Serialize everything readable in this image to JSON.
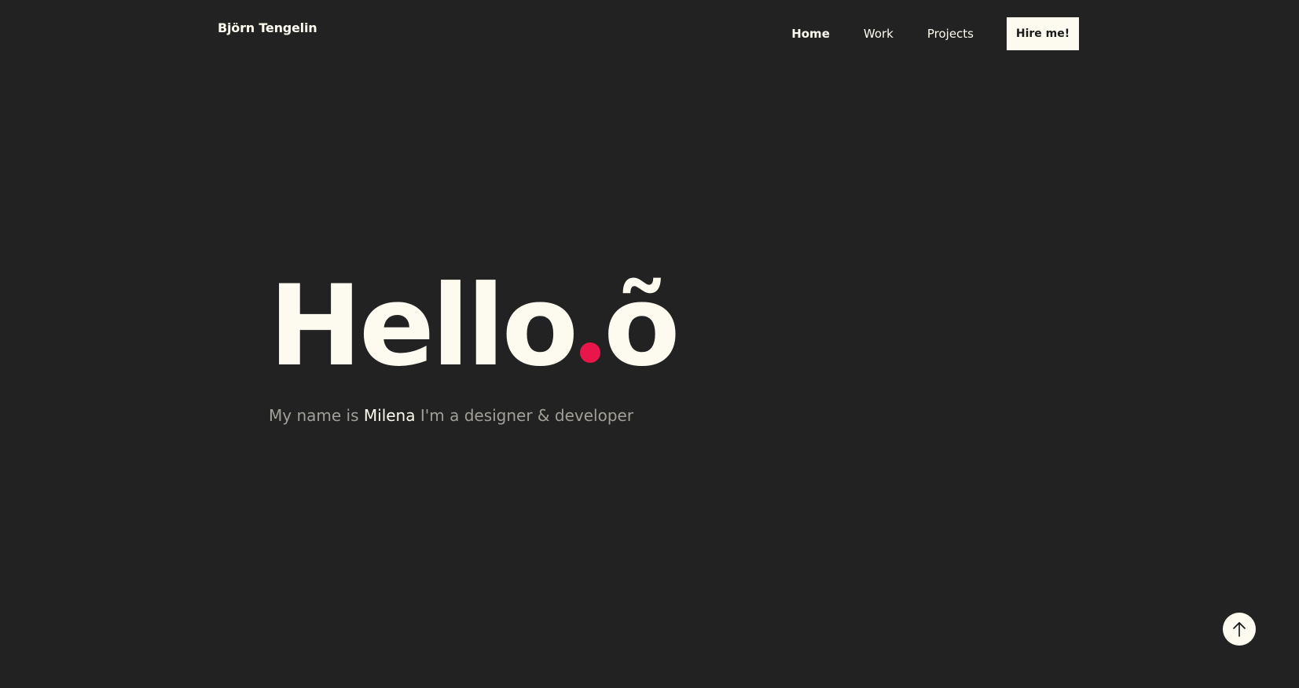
{
  "header": {
    "brand": "Björn Tengelin",
    "nav": [
      {
        "label": "Home",
        "active": true
      },
      {
        "label": "Work",
        "active": false
      },
      {
        "label": "Projects",
        "active": false
      }
    ],
    "cta_label": "Hire me!"
  },
  "hero": {
    "title_word": "Hello",
    "title_suffix": "õ",
    "tagline_prefix": "My name is",
    "tagline_name": "Milena",
    "tagline_suffix": "I'm a designer & developer"
  },
  "icons": {
    "scroll_top": "arrow-up-icon"
  },
  "colors": {
    "background": "#222222",
    "text": "#fdfbf0",
    "accent": "#e8164a",
    "muted_text": "#a19f98"
  }
}
